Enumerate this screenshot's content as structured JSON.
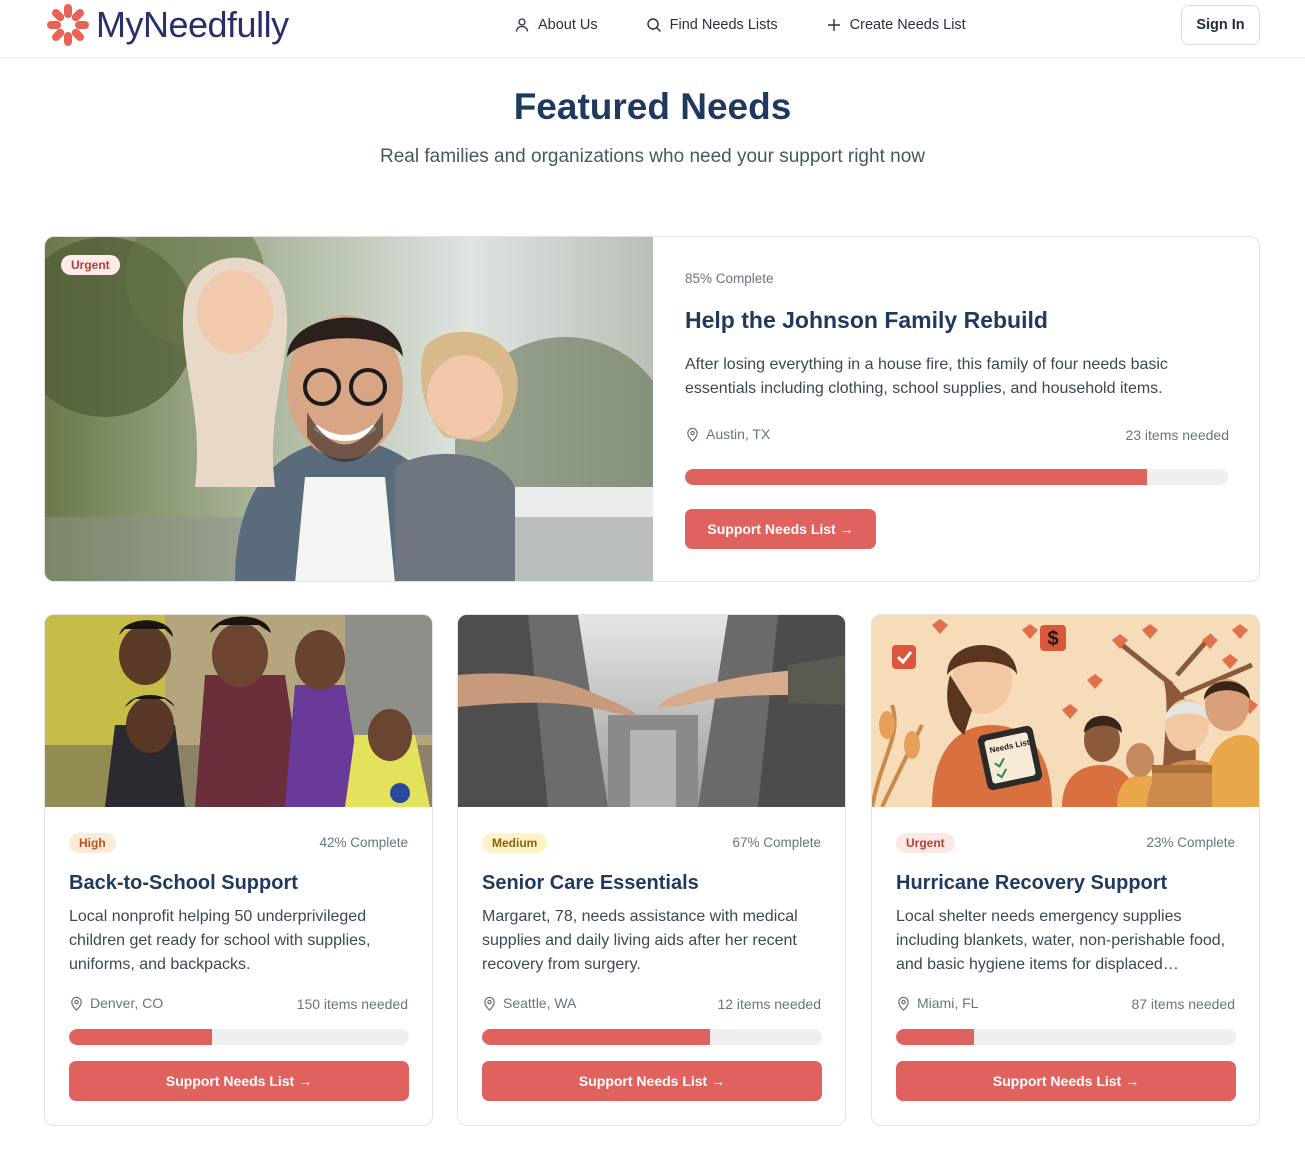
{
  "header": {
    "brand": "MyNeedfully",
    "nav": [
      {
        "label": "About Us",
        "icon": "user-icon"
      },
      {
        "label": "Find Needs Lists",
        "icon": "search-icon"
      },
      {
        "label": "Create Needs List",
        "icon": "plus-icon"
      }
    ],
    "sign_in_label": "Sign In"
  },
  "hero": {
    "title": "Featured Needs",
    "subtitle": "Real families and organizations who need your support right now"
  },
  "featured": {
    "badge": "Urgent",
    "progress_text": "85% Complete",
    "progress": 0.85,
    "title": "Help the Johnson Family Rebuild",
    "description": "After losing everything in a house fire, this family of four needs basic essentials including clothing, school supplies, and household items.",
    "location": "Austin, TX",
    "items_needed": "23 items needed",
    "button_label": "Support Needs List →"
  },
  "cards": [
    {
      "badge": "High",
      "progress_text": "42% Complete",
      "progress": 0.42,
      "title": "Back-to-School Support",
      "description": "Local nonprofit helping 50 underprivileged children get ready for school with supplies, uniforms, and backpacks.",
      "location": "Denver, CO",
      "items_needed": "150 items needed",
      "button_label": "Support Needs List →"
    },
    {
      "badge": "Medium",
      "progress_text": "67% Complete",
      "progress": 0.67,
      "title": "Senior Care Essentials",
      "description": "Margaret, 78, needs assistance with medical supplies and daily living aids after her recent recovery from surgery.",
      "location": "Seattle, WA",
      "items_needed": "12 items needed",
      "button_label": "Support Needs List →"
    },
    {
      "badge": "Urgent",
      "progress_text": "23% Complete",
      "progress": 0.23,
      "title": "Hurricane Recovery Support",
      "description": "Local shelter needs emergency supplies including blankets, water, non-perishable food, and basic hygiene items for displaced…",
      "location": "Miami, FL",
      "items_needed": "87 items needed",
      "button_label": "Support Needs List →"
    }
  ],
  "illustration_text": {
    "needs_list_tablet": "Needs List",
    "dollar_sign": "$"
  },
  "colors": {
    "accent": "#e0625e",
    "heading": "#1e3a5f",
    "brand_text": "#2a2f6b"
  }
}
